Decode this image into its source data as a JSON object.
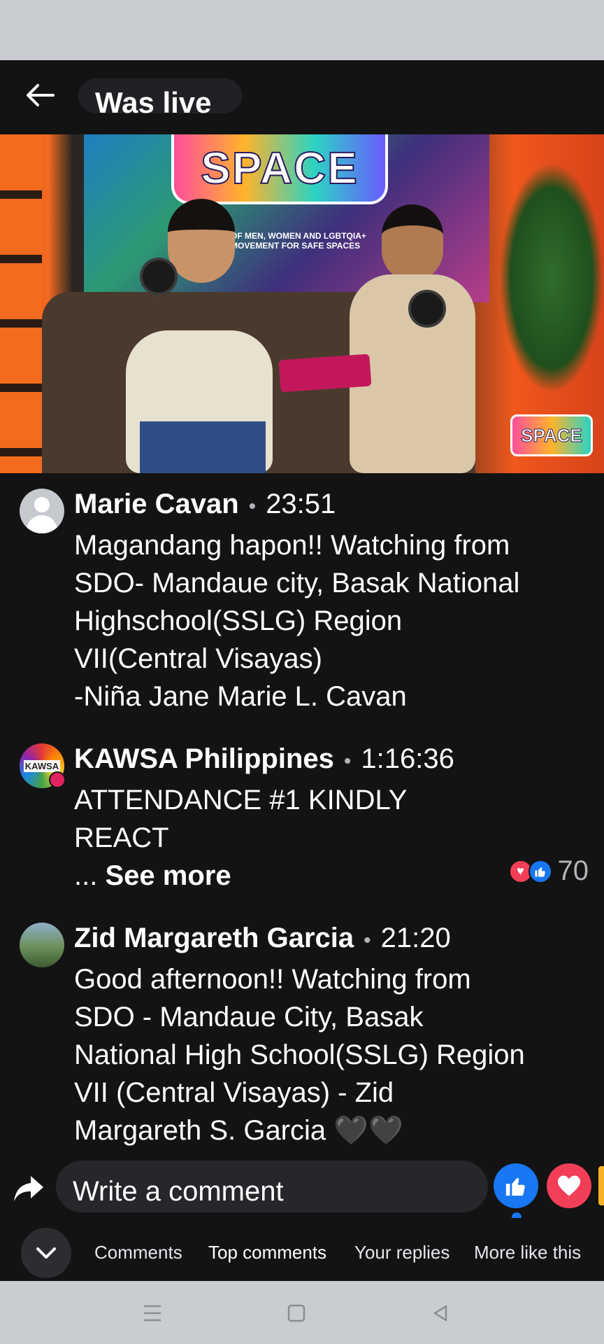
{
  "header": {
    "title": "Was live"
  },
  "video": {
    "screen_logo": "SPACE",
    "screen_subtitle": "OF MEN, WOMEN AND LGBTQIA+ MOVEMENT FOR SAFE SPACES",
    "corner_logo": "SPACE"
  },
  "comments": [
    {
      "author": "Marie Cavan",
      "time": "23:51",
      "lines": [
        "Magandang hapon!! Watching from",
        "SDO- Mandaue city, Basak National",
        "Highschool(SSLG) Region",
        "VII(Central Visayas)",
        "-Niña Jane Marie L. Cavan"
      ]
    },
    {
      "author": "KAWSA Philippines",
      "avatar_text": "KAWSA",
      "time": "1:16:36",
      "lines": [
        "ATTENDANCE #1 KINDLY",
        "REACT"
      ],
      "ellipsis": "...",
      "see_more": "See more",
      "reaction_count": "70",
      "reaction_icons": [
        "love-icon",
        "like-icon"
      ]
    },
    {
      "author": "Zid Margareth Garcia",
      "time": "21:20",
      "lines": [
        "Good afternoon!! Watching from",
        "SDO - Mandaue City, Basak",
        "National High School(SSLG) Region",
        "VII (Central Visayas) - Zid",
        "Margareth S. Garcia 🖤🖤"
      ]
    }
  ],
  "composer": {
    "placeholder": "Write a comment"
  },
  "tabs": [
    "Comments",
    "Top comments",
    "Your replies",
    "More like this"
  ],
  "colors": {
    "background": "#131314",
    "like_blue": "#1877f2",
    "love_red": "#f33e58",
    "system_bar": "#c9ccd1"
  }
}
